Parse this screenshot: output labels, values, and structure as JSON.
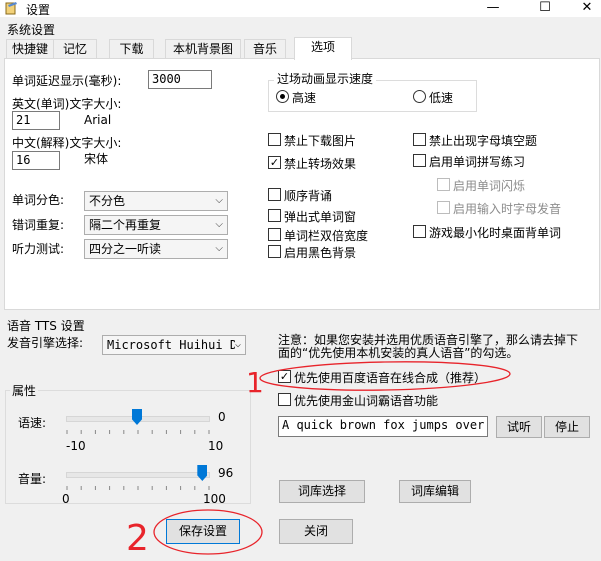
{
  "window": {
    "title": "设置",
    "minimize": "—",
    "maximize": "☐",
    "close": "✕"
  },
  "system_settings": {
    "caption": "系统设置"
  },
  "tabs": [
    {
      "label": "快捷键",
      "active": false
    },
    {
      "label": "记忆",
      "active": false
    },
    {
      "label": "下载",
      "active": false
    },
    {
      "label": "本机背景图",
      "active": false
    },
    {
      "label": "音乐",
      "active": false
    },
    {
      "label": "选项",
      "active": true
    }
  ],
  "options": {
    "delay_label": "单词延迟显示(毫秒):",
    "delay_value": "3000",
    "en_font_label": "英文(单词)文字大小:",
    "en_font_size": "21",
    "en_font_name": "Arial",
    "zh_font_label": "中文(解释)文字大小:",
    "zh_font_size": "16",
    "zh_font_name": "宋体",
    "color_label": "单词分色:",
    "color_value": "不分色",
    "repeat_label": "错词重复:",
    "repeat_value": "隔二个再重复",
    "listen_label": "听力测试:",
    "listen_value": "四分之一听读",
    "transition": {
      "caption": "过场动画显示速度",
      "fast": "高速",
      "slow": "低速",
      "selected": "fast"
    },
    "col2": [
      {
        "label": "禁止下载图片",
        "checked": false
      },
      {
        "label": "禁止转场效果",
        "checked": true
      },
      {
        "label": "顺序背诵",
        "checked": false
      },
      {
        "label": "弹出式单词窗",
        "checked": false
      },
      {
        "label": "单词栏双倍宽度",
        "checked": false
      },
      {
        "label": "启用黑色背景",
        "checked": false
      }
    ],
    "col3": [
      {
        "label": "禁止出现字母填空题",
        "checked": false,
        "disabled": false
      },
      {
        "label": "启用单词拼写练习",
        "checked": false,
        "disabled": false
      },
      {
        "label": "启用单词闪烁",
        "checked": false,
        "disabled": true
      },
      {
        "label": "启用输入时字母发音",
        "checked": false,
        "disabled": true
      },
      {
        "label": "游戏最小化时桌面背单词",
        "checked": false,
        "disabled": false
      }
    ]
  },
  "tts": {
    "caption": "语音 TTS 设置",
    "engine_label": "发音引擎选择:",
    "engine_value": "Microsoft Huihui D",
    "note": "注意：如果您安装并选用优质语音引擎了，那么请去掉下面的“优先使用本机安装的真人语音”的勾选。",
    "baidu_label": "优先使用百度语音在线合成（推荐）",
    "baidu_checked": true,
    "jinshan_label": "优先使用金山词霸语音功能",
    "jinshan_checked": false,
    "sample_text": "A quick brown fox jumps over",
    "listen_button": "试听",
    "stop_button": "停止",
    "lexicon_select": "词库选择",
    "lexicon_edit": "词库编辑",
    "props": {
      "caption": "属性",
      "rate_label": "语速:",
      "rate_value": "0",
      "rate_min": "-10",
      "rate_max": "10",
      "rate_fraction": 0.5,
      "volume_label": "音量:",
      "volume_value": "96",
      "volume_min": "0",
      "volume_max": "100",
      "volume_fraction": 0.96
    }
  },
  "footer": {
    "save": "保存设置",
    "close": "关闭"
  },
  "annotations": {
    "mark1": "1",
    "mark2": "2",
    "color": "#e8242b"
  }
}
